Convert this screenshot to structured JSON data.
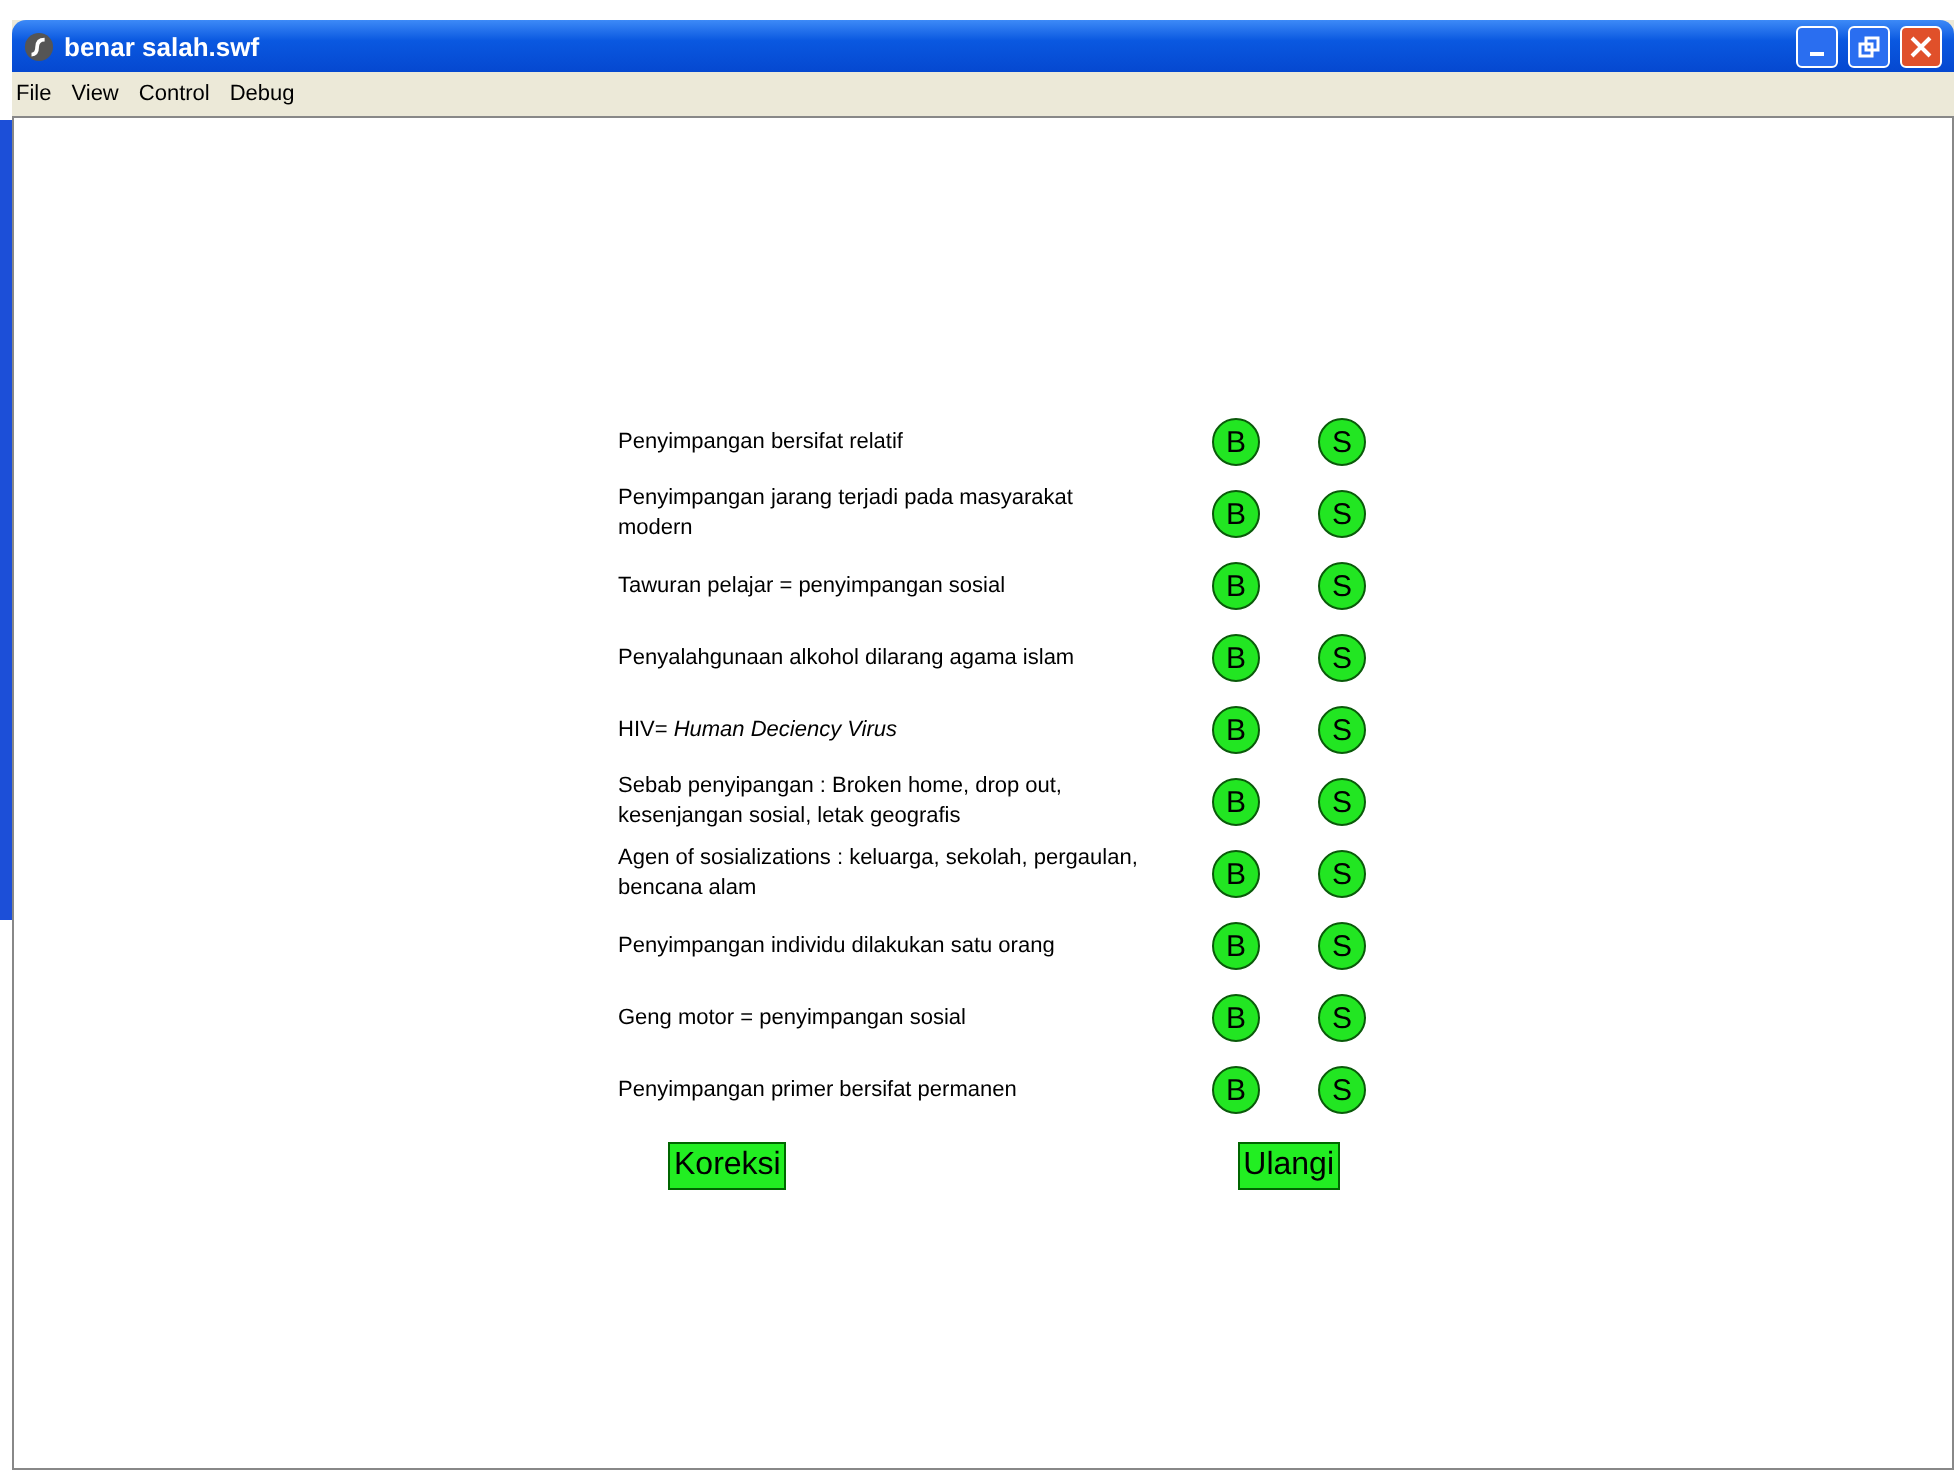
{
  "window": {
    "title": "benar salah.swf"
  },
  "menu": [
    "File",
    "View",
    "Control",
    "Debug"
  ],
  "questions": [
    {
      "text": "Penyimpangan bersifat relatif",
      "true_label": "B",
      "false_label": "S"
    },
    {
      "text": "Penyimpangan jarang terjadi pada masyarakat modern",
      "true_label": "B",
      "false_label": "S"
    },
    {
      "text": "Tawuran pelajar = penyimpangan sosial",
      "true_label": "B",
      "false_label": "S"
    },
    {
      "text": "Penyalahgunaan alkohol dilarang agama islam",
      "true_label": "B",
      "false_label": "S"
    },
    {
      "text": "HIV= *Human Deciency Virus*",
      "true_label": "B",
      "false_label": "S"
    },
    {
      "text": "Sebab penyipangan : Broken home, drop out, kesenjangan sosial, letak geografis",
      "true_label": "B",
      "false_label": "S"
    },
    {
      "text": "Agen of sosializations : keluarga, sekolah, pergaulan, bencana alam",
      "true_label": "B",
      "false_label": "S"
    },
    {
      "text": "Penyimpangan individu dilakukan satu orang",
      "true_label": "B",
      "false_label": "S"
    },
    {
      "text": "Geng motor = penyimpangan sosial",
      "true_label": "B",
      "false_label": "S"
    },
    {
      "text": "Penyimpangan primer bersifat permanen",
      "true_label": "B",
      "false_label": "S"
    }
  ],
  "actions": [
    "Koreksi",
    "Ulangi"
  ]
}
